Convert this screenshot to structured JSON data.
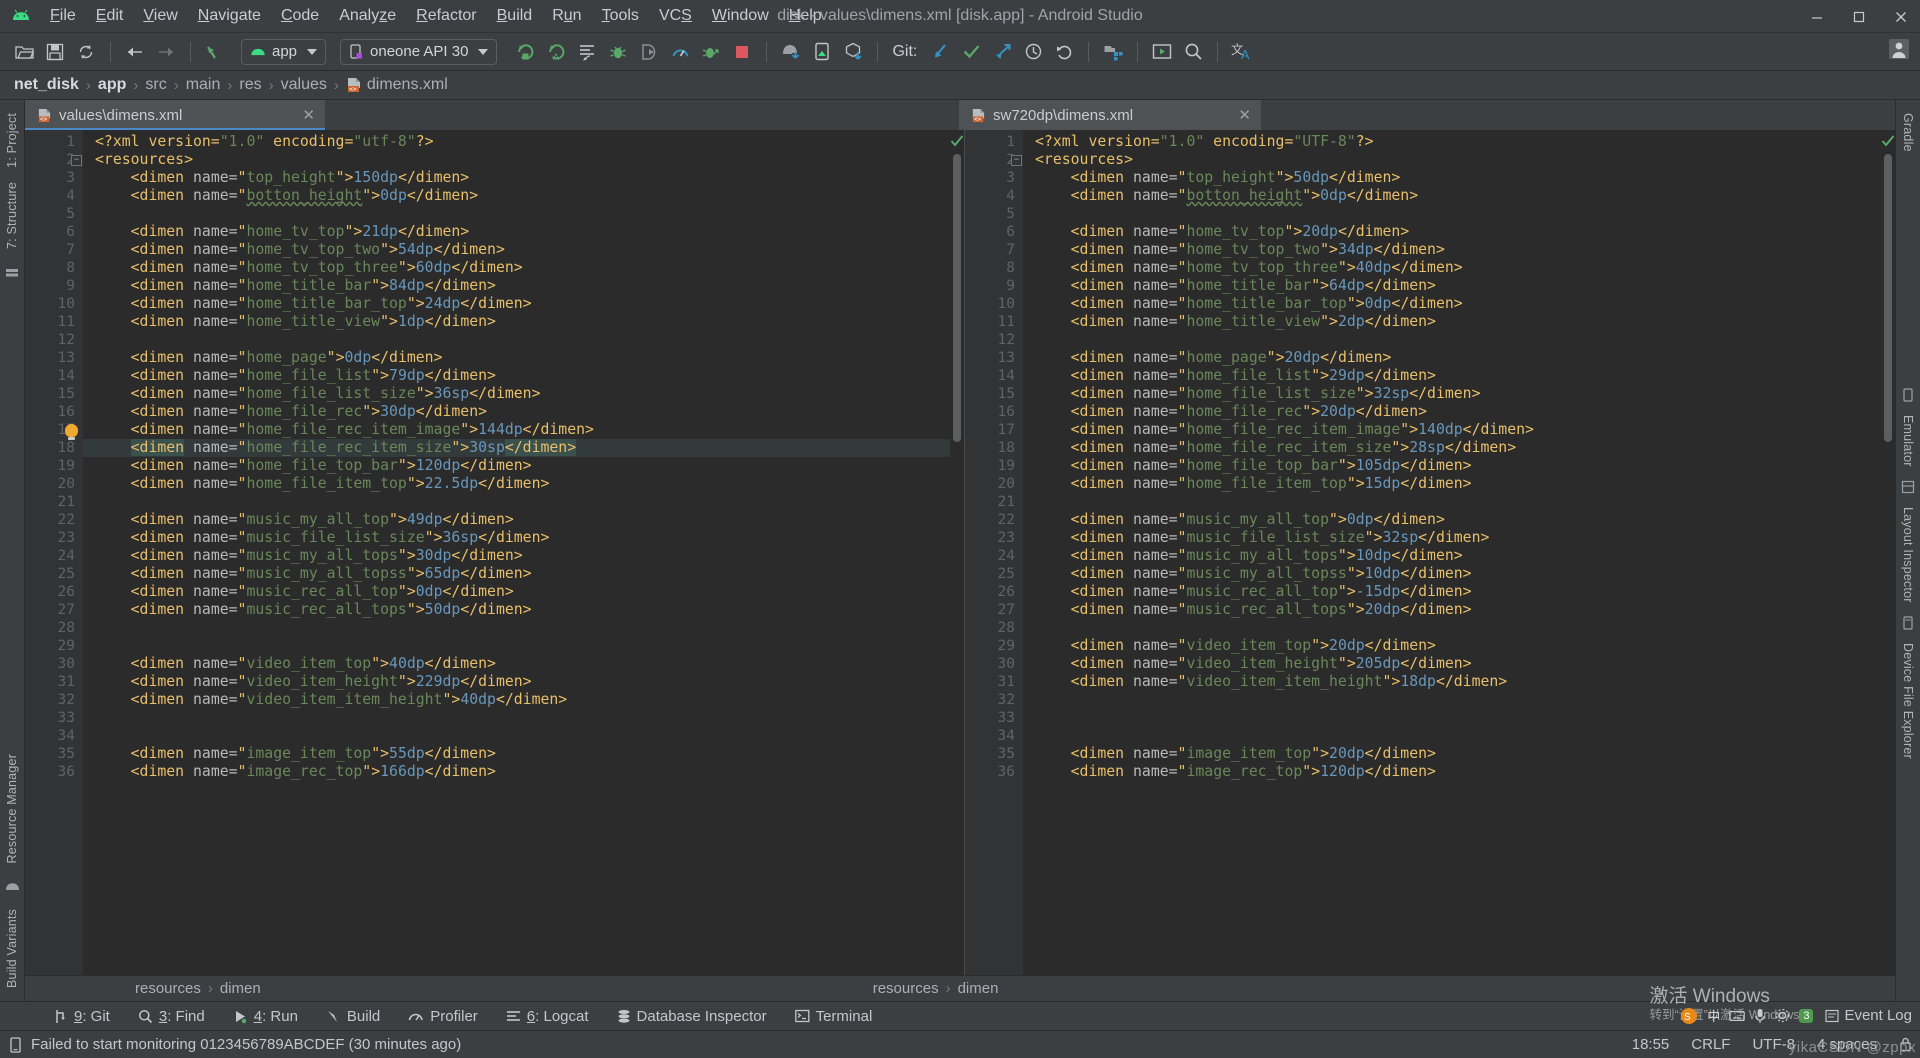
{
  "window": {
    "title": "disk - values\\dimens.xml [disk.app] - Android Studio",
    "minimize": "—",
    "maximize": "▢",
    "close": "✕"
  },
  "menu": {
    "items": [
      {
        "label": "File",
        "accel": "F"
      },
      {
        "label": "Edit",
        "accel": "E"
      },
      {
        "label": "View",
        "accel": "V"
      },
      {
        "label": "Navigate",
        "accel": "N"
      },
      {
        "label": "Code",
        "accel": "C"
      },
      {
        "label": "Analyze",
        "accel": "z"
      },
      {
        "label": "Refactor",
        "accel": "R"
      },
      {
        "label": "Build",
        "accel": "B"
      },
      {
        "label": "Run",
        "accel": "u"
      },
      {
        "label": "Tools",
        "accel": "T"
      },
      {
        "label": "VCS",
        "accel": "S"
      },
      {
        "label": "Window",
        "accel": "W"
      },
      {
        "label": "Help",
        "accel": "H"
      }
    ]
  },
  "toolbar": {
    "open_icon": "open-folder-icon",
    "save_icon": "save-icon",
    "sync_icon": "sync-project-icon",
    "back_icon": "navigate-back-icon",
    "forward_icon": "navigate-forward-icon",
    "undo_icon": "undo-arrow-icon",
    "module_combo": "app",
    "device_combo": "oneone API 30",
    "run_icon": "run-icon",
    "run_select_icon": "run-with-coverage-icon",
    "apply_changes_icon": "apply-changes-icon",
    "debug_icon": "debug-icon",
    "attach_debugger_icon": "attach-debugger-icon",
    "profiler_icon": "profiler-icon",
    "profile_debug_icon": "profile-debug-icon",
    "stop_icon": "stop-icon",
    "avd_icon": "avd-manager-icon",
    "sdk_icon": "sdk-manager-icon",
    "sync_gradle_icon": "sync-gradle-icon",
    "git_label": "Git:",
    "git_update_icon": "git-update-icon",
    "git_commit_icon": "git-commit-icon",
    "git_push_icon": "git-push-icon",
    "git_history_icon": "git-history-icon",
    "git_revert_icon": "git-revert-icon",
    "project_structure_icon": "project-structure-icon",
    "layout_preview_icon": "layout-preview-icon",
    "search_icon": "search-everywhere-icon",
    "translate_icon": "translate-icon",
    "account_icon": "user-account-icon"
  },
  "breadcrumb": {
    "items": [
      "net_disk",
      "app",
      "src",
      "main",
      "res",
      "values",
      "dimens.xml"
    ],
    "separator": "›",
    "file_icon": "xml-file-icon"
  },
  "left_rail": {
    "top": [
      "1: Project",
      "7: Structure"
    ],
    "bottom": [
      "Resource Manager",
      "Build Variants"
    ],
    "favorites_icon": "favorites-icon",
    "android_icon": "android-icon"
  },
  "right_rail": {
    "items": [
      "Gradle",
      "Emulator",
      "Layout Inspector",
      "Device File Explorer"
    ]
  },
  "editor": {
    "tabs": [
      {
        "label": "values\\dimens.xml",
        "active": true,
        "close": "✕",
        "icon": "xml-file-icon"
      },
      {
        "label": "sw720dp\\dimens.xml",
        "active": false,
        "close": "✕",
        "icon": "xml-file-icon"
      }
    ],
    "footer_crumbs_left": [
      "resources",
      "dimen"
    ],
    "footer_crumbs_right": [
      "resources",
      "dimen"
    ],
    "footer_sep": "›",
    "inspection_ok_icon": "inspection-ok-checkmark"
  },
  "code_left": {
    "first_line": 1,
    "lines": [
      {
        "n": 1,
        "indent": 0,
        "kind": "decl",
        "text": "<?xml version=\"1.0\" encoding=\"utf-8\"?>"
      },
      {
        "n": 2,
        "indent": 0,
        "kind": "open",
        "text": "<resources>",
        "fold": true
      },
      {
        "n": 3,
        "indent": 1,
        "kind": "dimen",
        "name": "top_height",
        "value": "150dp"
      },
      {
        "n": 4,
        "indent": 1,
        "kind": "dimen",
        "name": "botton_height",
        "value": "0dp",
        "typo": true
      },
      {
        "n": 5,
        "indent": 0,
        "kind": "blank"
      },
      {
        "n": 6,
        "indent": 1,
        "kind": "dimen",
        "name": "home_tv_top",
        "value": "21dp"
      },
      {
        "n": 7,
        "indent": 1,
        "kind": "dimen",
        "name": "home_tv_top_two",
        "value": "54dp"
      },
      {
        "n": 8,
        "indent": 1,
        "kind": "dimen",
        "name": "home_tv_top_three",
        "value": "60dp"
      },
      {
        "n": 9,
        "indent": 1,
        "kind": "dimen",
        "name": "home_title_bar",
        "value": "84dp"
      },
      {
        "n": 10,
        "indent": 1,
        "kind": "dimen",
        "name": "home_title_bar_top",
        "value": "24dp"
      },
      {
        "n": 11,
        "indent": 1,
        "kind": "dimen",
        "name": "home_title_view",
        "value": "1dp"
      },
      {
        "n": 12,
        "indent": 0,
        "kind": "blank"
      },
      {
        "n": 13,
        "indent": 1,
        "kind": "dimen",
        "name": "home_page",
        "value": "0dp"
      },
      {
        "n": 14,
        "indent": 1,
        "kind": "dimen",
        "name": "home_file_list",
        "value": "79dp"
      },
      {
        "n": 15,
        "indent": 1,
        "kind": "dimen",
        "name": "home_file_list_size",
        "value": "36sp"
      },
      {
        "n": 16,
        "indent": 1,
        "kind": "dimen",
        "name": "home_file_rec",
        "value": "30dp"
      },
      {
        "n": 17,
        "indent": 1,
        "kind": "dimen",
        "name": "home_file_rec_item_image",
        "value": "144dp",
        "bulb": true
      },
      {
        "n": 18,
        "indent": 1,
        "kind": "dimen",
        "name": "home_file_rec_item_size",
        "value": "30sp",
        "highlight": true,
        "selected": true
      },
      {
        "n": 19,
        "indent": 1,
        "kind": "dimen",
        "name": "home_file_top_bar",
        "value": "120dp"
      },
      {
        "n": 20,
        "indent": 1,
        "kind": "dimen",
        "name": "home_file_item_top",
        "value": "22.5dp"
      },
      {
        "n": 21,
        "indent": 0,
        "kind": "blank"
      },
      {
        "n": 22,
        "indent": 1,
        "kind": "dimen",
        "name": "music_my_all_top",
        "value": "49dp"
      },
      {
        "n": 23,
        "indent": 1,
        "kind": "dimen",
        "name": "music_file_list_size",
        "value": "36sp"
      },
      {
        "n": 24,
        "indent": 1,
        "kind": "dimen",
        "name": "music_my_all_tops",
        "value": "30dp"
      },
      {
        "n": 25,
        "indent": 1,
        "kind": "dimen",
        "name": "music_my_all_topss",
        "value": "65dp"
      },
      {
        "n": 26,
        "indent": 1,
        "kind": "dimen",
        "name": "music_rec_all_top",
        "value": "0dp"
      },
      {
        "n": 27,
        "indent": 1,
        "kind": "dimen",
        "name": "music_rec_all_tops",
        "value": "50dp"
      },
      {
        "n": 28,
        "indent": 0,
        "kind": "blank"
      },
      {
        "n": 29,
        "indent": 0,
        "kind": "blank"
      },
      {
        "n": 30,
        "indent": 1,
        "kind": "dimen",
        "name": "video_item_top",
        "value": "40dp"
      },
      {
        "n": 31,
        "indent": 1,
        "kind": "dimen",
        "name": "video_item_height",
        "value": "229dp"
      },
      {
        "n": 32,
        "indent": 1,
        "kind": "dimen",
        "name": "video_item_item_height",
        "value": "40dp"
      },
      {
        "n": 33,
        "indent": 0,
        "kind": "blank"
      },
      {
        "n": 34,
        "indent": 0,
        "kind": "blank"
      },
      {
        "n": 35,
        "indent": 1,
        "kind": "dimen",
        "name": "image_item_top",
        "value": "55dp"
      },
      {
        "n": 36,
        "indent": 1,
        "kind": "dimen",
        "name": "image_rec_top",
        "value": "166dp"
      }
    ]
  },
  "code_right": {
    "lines": [
      {
        "n": 1,
        "indent": 0,
        "kind": "decl",
        "text": "<?xml version=\"1.0\" encoding=\"UTF-8\"?>"
      },
      {
        "n": 2,
        "indent": 0,
        "kind": "open",
        "text": "<resources>",
        "fold": true
      },
      {
        "n": 3,
        "indent": 1,
        "kind": "dimen",
        "name": "top_height",
        "value": "50dp"
      },
      {
        "n": 4,
        "indent": 1,
        "kind": "dimen",
        "name": "botton_height",
        "value": "0dp",
        "typo": true
      },
      {
        "n": 5,
        "indent": 0,
        "kind": "blank"
      },
      {
        "n": 6,
        "indent": 1,
        "kind": "dimen",
        "name": "home_tv_top",
        "value": "20dp"
      },
      {
        "n": 7,
        "indent": 1,
        "kind": "dimen",
        "name": "home_tv_top_two",
        "value": "34dp"
      },
      {
        "n": 8,
        "indent": 1,
        "kind": "dimen",
        "name": "home_tv_top_three",
        "value": "40dp"
      },
      {
        "n": 9,
        "indent": 1,
        "kind": "dimen",
        "name": "home_title_bar",
        "value": "64dp"
      },
      {
        "n": 10,
        "indent": 1,
        "kind": "dimen",
        "name": "home_title_bar_top",
        "value": "0dp"
      },
      {
        "n": 11,
        "indent": 1,
        "kind": "dimen",
        "name": "home_title_view",
        "value": "2dp"
      },
      {
        "n": 12,
        "indent": 0,
        "kind": "blank"
      },
      {
        "n": 13,
        "indent": 1,
        "kind": "dimen",
        "name": "home_page",
        "value": "20dp"
      },
      {
        "n": 14,
        "indent": 1,
        "kind": "dimen",
        "name": "home_file_list",
        "value": "29dp"
      },
      {
        "n": 15,
        "indent": 1,
        "kind": "dimen",
        "name": "home_file_list_size",
        "value": "32sp"
      },
      {
        "n": 16,
        "indent": 1,
        "kind": "dimen",
        "name": "home_file_rec",
        "value": "20dp"
      },
      {
        "n": 17,
        "indent": 1,
        "kind": "dimen",
        "name": "home_file_rec_item_image",
        "value": "140dp"
      },
      {
        "n": 18,
        "indent": 1,
        "kind": "dimen",
        "name": "home_file_rec_item_size",
        "value": "28sp"
      },
      {
        "n": 19,
        "indent": 1,
        "kind": "dimen",
        "name": "home_file_top_bar",
        "value": "105dp"
      },
      {
        "n": 20,
        "indent": 1,
        "kind": "dimen",
        "name": "home_file_item_top",
        "value": "15dp"
      },
      {
        "n": 21,
        "indent": 0,
        "kind": "blank"
      },
      {
        "n": 22,
        "indent": 1,
        "kind": "dimen",
        "name": "music_my_all_top",
        "value": "0dp"
      },
      {
        "n": 23,
        "indent": 1,
        "kind": "dimen",
        "name": "music_file_list_size",
        "value": "32sp"
      },
      {
        "n": 24,
        "indent": 1,
        "kind": "dimen",
        "name": "music_my_all_tops",
        "value": "10dp"
      },
      {
        "n": 25,
        "indent": 1,
        "kind": "dimen",
        "name": "music_my_all_topss",
        "value": "10dp"
      },
      {
        "n": 26,
        "indent": 1,
        "kind": "dimen",
        "name": "music_rec_all_top",
        "value": "-15dp"
      },
      {
        "n": 27,
        "indent": 1,
        "kind": "dimen",
        "name": "music_rec_all_tops",
        "value": "20dp"
      },
      {
        "n": 28,
        "indent": 0,
        "kind": "blank"
      },
      {
        "n": 29,
        "indent": 1,
        "kind": "dimen",
        "name": "video_item_top",
        "value": "20dp"
      },
      {
        "n": 30,
        "indent": 1,
        "kind": "dimen",
        "name": "video_item_height",
        "value": "205dp"
      },
      {
        "n": 31,
        "indent": 1,
        "kind": "dimen",
        "name": "video_item_item_height",
        "value": "18dp"
      },
      {
        "n": 32,
        "indent": 0,
        "kind": "blank"
      },
      {
        "n": 33,
        "indent": 0,
        "kind": "blank"
      },
      {
        "n": 34,
        "indent": 0,
        "kind": "blank"
      },
      {
        "n": 35,
        "indent": 1,
        "kind": "dimen",
        "name": "image_item_top",
        "value": "20dp"
      },
      {
        "n": 36,
        "indent": 1,
        "kind": "dimen",
        "name": "image_rec_top",
        "value": "120dp"
      }
    ]
  },
  "toolwindows": {
    "items": [
      {
        "label": "9: Git",
        "num": "9",
        "rest": ": Git",
        "icon": "git-branch-icon"
      },
      {
        "label": "3: Find",
        "num": "3",
        "rest": ": Find",
        "icon": "find-icon"
      },
      {
        "label": "4: Run",
        "num": "4",
        "rest": ": Run",
        "icon": "run-triangle-icon"
      },
      {
        "label": "Build",
        "num": "",
        "rest": "Build",
        "icon": "build-hammer-icon"
      },
      {
        "label": "Profiler",
        "num": "",
        "rest": "Profiler",
        "icon": "profiler-icon"
      },
      {
        "label": "6: Logcat",
        "num": "6",
        "rest": ": Logcat",
        "icon": "logcat-icon"
      },
      {
        "label": "Database Inspector",
        "num": "",
        "rest": "Database Inspector",
        "icon": "database-icon"
      },
      {
        "label": "Terminal",
        "num": "",
        "rest": "Terminal",
        "icon": "terminal-icon"
      }
    ]
  },
  "status": {
    "message": "Failed to start monitoring 0123456789ABCDEF (30 minutes ago)",
    "message_icon": "device-icon",
    "time": "18:55",
    "line_ending": "CRLF",
    "encoding": "UTF-8",
    "indent": "4 spaces",
    "lock_icon": "lock-icon",
    "event_log": "Event Log",
    "event_log_count": "3",
    "event_log_icon": "event-log-icon"
  },
  "watermark": {
    "line1": "激活 Windows",
    "line2": "转到“设置”以激活 Windows。",
    "csdn": "yikaCSDN @zppx"
  },
  "tray": {
    "ime": "中",
    "items": [
      "keyboard-icon",
      "microphone-icon",
      "settings-icon",
      "notification-icon"
    ]
  },
  "colors": {
    "background": "#3c3f41",
    "editor_bg": "#2b2b2b",
    "gutter_bg": "#313335",
    "accent_blue": "#4a88c7",
    "accent_green": "#59a869",
    "tag": "#e8bf6a",
    "value": "#6a8759",
    "number": "#6897bb",
    "plain": "#a9b7c6",
    "xml_icon": "#cc6633",
    "highlight_row": "#323a3c",
    "selection": "#214283"
  }
}
